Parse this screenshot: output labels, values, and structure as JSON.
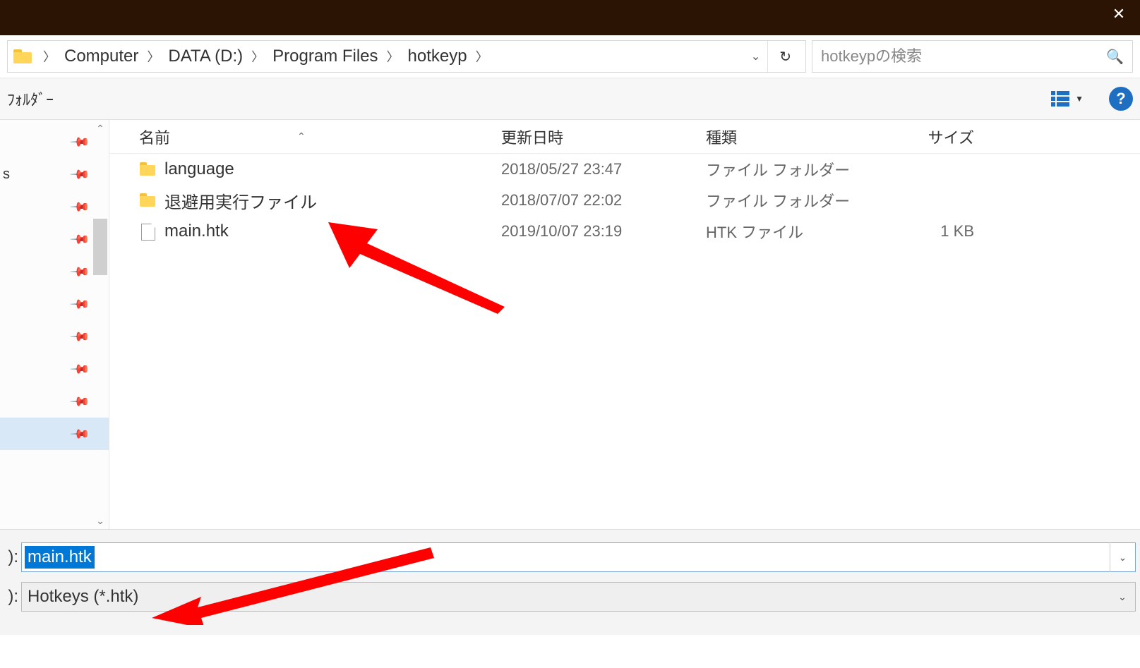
{
  "breadcrumb": {
    "items": [
      "Computer",
      "DATA (D:)",
      "Program Files",
      "hotkeyp"
    ]
  },
  "search": {
    "placeholder": "hotkeypの検索"
  },
  "toolbar": {
    "left_label": "ﾌｫﾙﾀﾞｰ"
  },
  "sidebar": {
    "items": [
      {
        "label": ""
      },
      {
        "label": "s"
      },
      {
        "label": ""
      },
      {
        "label": ""
      },
      {
        "label": ""
      },
      {
        "label": ""
      },
      {
        "label": ""
      },
      {
        "label": ""
      },
      {
        "label": ""
      },
      {
        "label": ""
      }
    ]
  },
  "columns": {
    "name": "名前",
    "date": "更新日時",
    "type": "種類",
    "size": "サイズ"
  },
  "files": [
    {
      "icon": "folder",
      "name": "language",
      "date": "2018/05/27 23:47",
      "type": "ファイル フォルダー",
      "size": ""
    },
    {
      "icon": "folder",
      "name": "退避用実行ファイル",
      "date": "2018/07/07 22:02",
      "type": "ファイル フォルダー",
      "size": ""
    },
    {
      "icon": "file",
      "name": "main.htk",
      "date": "2019/10/07 23:19",
      "type": "HTK ファイル",
      "size": "1 KB"
    }
  ],
  "bottom": {
    "filename_label": "):",
    "filename_value": "main.htk",
    "filetype_label": "):",
    "filetype_value": "Hotkeys (*.htk)"
  }
}
